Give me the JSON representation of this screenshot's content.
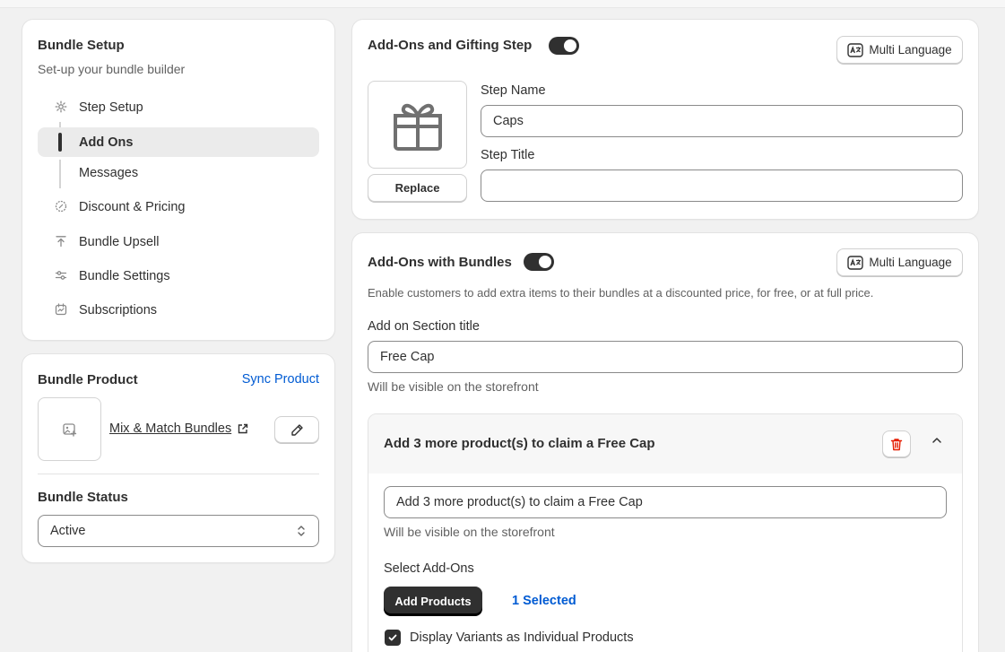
{
  "bundle_setup": {
    "title": "Bundle Setup",
    "subtitle": "Set-up your bundle builder",
    "nav": [
      {
        "label": "Step Setup",
        "icon": "gear-icon"
      },
      {
        "label": "Add Ons",
        "active": true
      },
      {
        "label": "Messages"
      },
      {
        "label": "Discount & Pricing",
        "icon": "badge-icon"
      },
      {
        "label": "Bundle Upsell",
        "icon": "upload-icon"
      },
      {
        "label": "Bundle Settings",
        "icon": "sliders-icon"
      },
      {
        "label": "Subscriptions",
        "icon": "calendar-icon"
      }
    ]
  },
  "bundle_product": {
    "title": "Bundle Product",
    "sync_label": "Sync Product",
    "product_name": "Mix & Match Bundles",
    "status_title": "Bundle Status",
    "status_value": "Active"
  },
  "gifting_step": {
    "title": "Add-Ons and Gifting Step",
    "toggle_on": true,
    "multi_language_label": "Multi Language",
    "replace_label": "Replace",
    "step_name_label": "Step Name",
    "step_name_value": "Caps",
    "step_title_label": "Step Title",
    "step_title_value": ""
  },
  "addons_bundles": {
    "title": "Add-Ons with Bundles",
    "toggle_on": true,
    "multi_language_label": "Multi Language",
    "description": "Enable customers to add extra items to their bundles at a discounted price, for free, or at full price.",
    "section_title_label": "Add on Section title",
    "section_title_value": "Free Cap",
    "section_title_help": "Will be visible on the storefront",
    "tier": {
      "heading": "Add 3 more product(s) to claim a Free Cap",
      "message_value": "Add 3 more product(s) to claim a Free Cap",
      "message_help": "Will be visible on the storefront",
      "select_label": "Select Add-Ons",
      "add_products_label": "Add Products",
      "selected_label": "1 Selected",
      "variants_checkbox_label": "Display Variants as Individual Products",
      "variants_checked": true
    }
  },
  "colors": {
    "link": "#005bd3",
    "primary_button": "#303030",
    "delete_icon": "#e51c00"
  }
}
